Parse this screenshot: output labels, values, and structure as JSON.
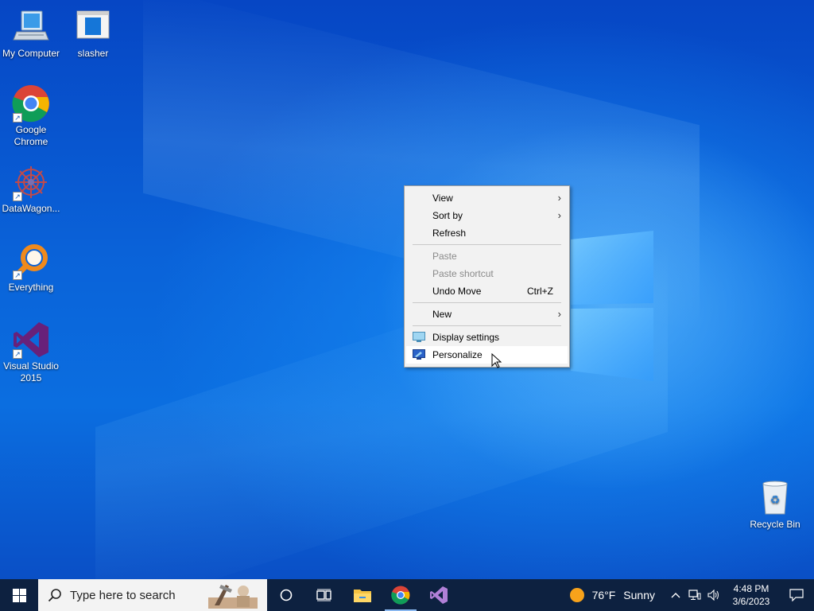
{
  "desktop": {
    "icons": [
      {
        "label": "My Computer",
        "icon": "computer-icon"
      },
      {
        "label": "slasher",
        "icon": "window-app-icon"
      },
      {
        "label": "Google Chrome",
        "icon": "chrome-icon"
      },
      {
        "label": "DataWagon...",
        "icon": "datawagon-icon"
      },
      {
        "label": "Everything",
        "icon": "everything-search-icon"
      },
      {
        "label": "Visual Studio 2015",
        "icon": "visual-studio-icon"
      },
      {
        "label": "Recycle Bin",
        "icon": "recycle-bin-icon"
      }
    ]
  },
  "context_menu": {
    "items": [
      {
        "label": "View",
        "submenu": true
      },
      {
        "label": "Sort by",
        "submenu": true
      },
      {
        "label": "Refresh"
      },
      {
        "label": "Paste",
        "disabled": true
      },
      {
        "label": "Paste shortcut",
        "disabled": true
      },
      {
        "label": "Undo Move",
        "shortcut": "Ctrl+Z"
      },
      {
        "label": "New",
        "submenu": true
      },
      {
        "label": "Display settings",
        "icon": "display-settings-icon"
      },
      {
        "label": "Personalize",
        "icon": "personalize-icon",
        "hovered": true
      }
    ]
  },
  "taskbar": {
    "search_placeholder": "Type here to search",
    "pinned": [
      "cortana-icon",
      "task-view-icon",
      "file-explorer-icon",
      "chrome-icon",
      "visual-studio-icon"
    ],
    "weather": {
      "temp": "76°F",
      "condition": "Sunny"
    },
    "clock": {
      "time": "4:48 PM",
      "date": "3/6/2023"
    }
  },
  "colors": {
    "taskbar_bg": "#0d2140",
    "menu_bg": "#f2f2f2",
    "wallpaper": "#0a63d9"
  }
}
